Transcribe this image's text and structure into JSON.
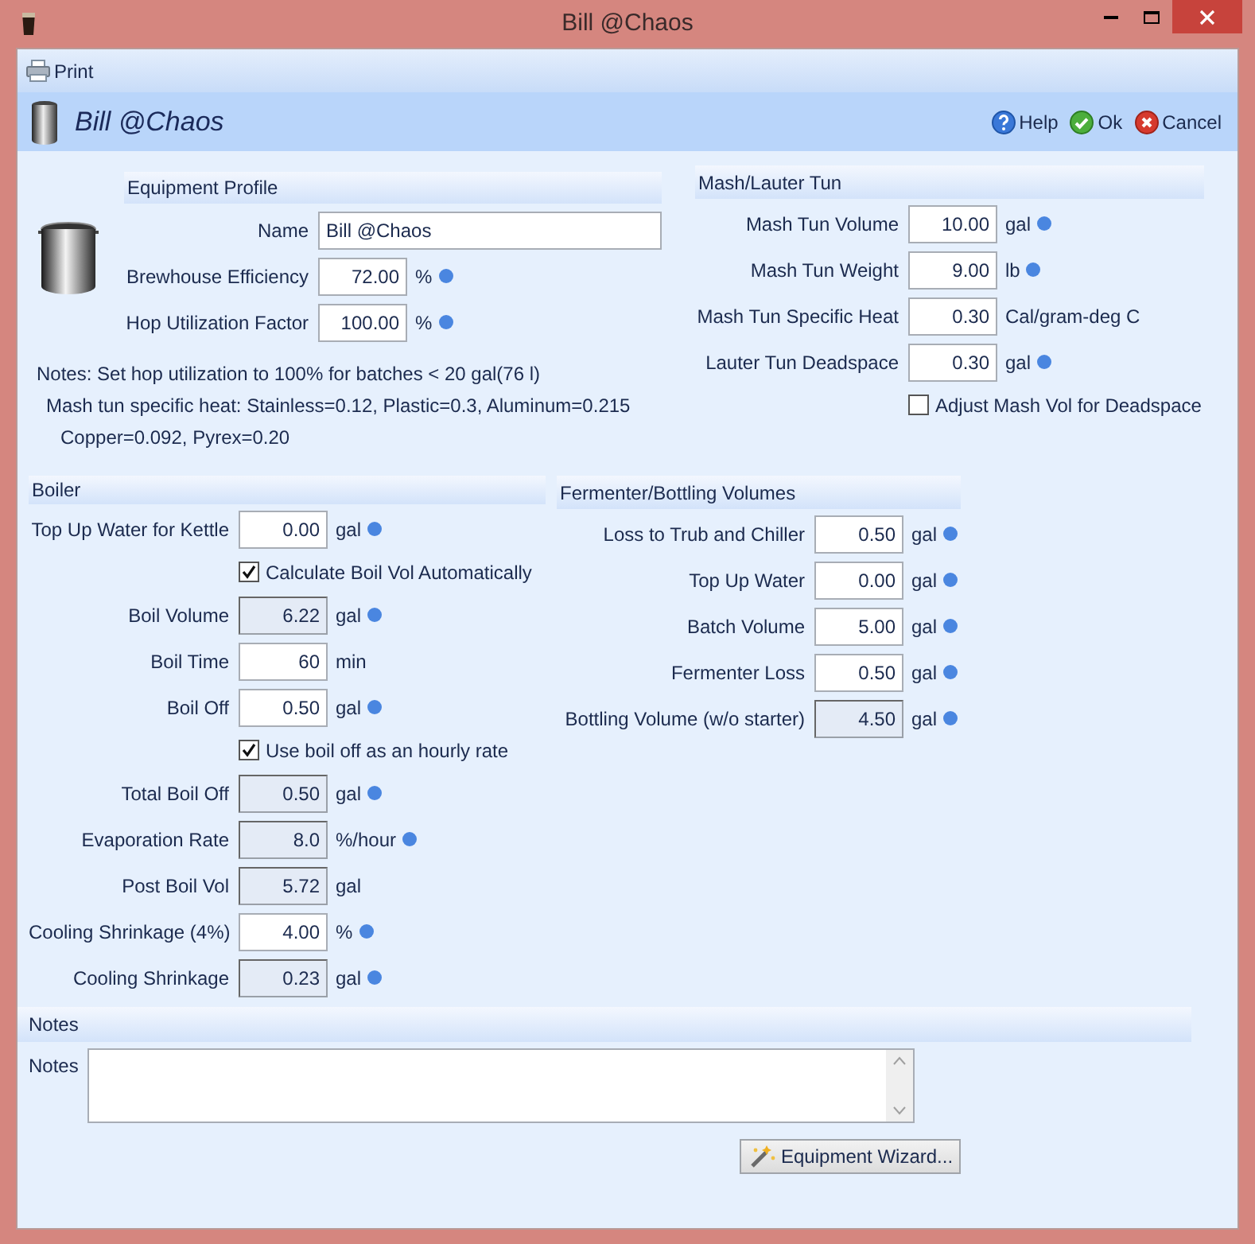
{
  "window": {
    "title": "Bill @Chaos"
  },
  "toolbar": [
    {
      "label": "Print"
    }
  ],
  "header": {
    "title": "Bill @Chaos",
    "buttons": [
      {
        "label": "Help",
        "kind": "help"
      },
      {
        "label": "Ok",
        "kind": "ok"
      },
      {
        "label": "Cancel",
        "kind": "cancel"
      }
    ]
  },
  "equipment_profile": {
    "title": "Equipment Profile",
    "rows": [
      {
        "kind": "text",
        "label": "Name",
        "value": "Bill @Chaos"
      },
      {
        "kind": "number",
        "label": "Brewhouse Efficiency",
        "value": "72.00",
        "unit": "%",
        "info": true,
        "readonly": false
      },
      {
        "kind": "number",
        "label": "Hop Utilization Factor",
        "value": "100.00",
        "unit": "%",
        "info": true,
        "readonly": false
      }
    ],
    "notes": [
      "Notes: Set hop utilization to 100% for batches < 20 gal(76 l)",
      "Mash tun specific heat: Stainless=0.12, Plastic=0.3, Aluminum=0.215",
      "Copper=0.092, Pyrex=0.20"
    ]
  },
  "mash_lauter_tun": {
    "title": "Mash/Lauter Tun",
    "rows": [
      {
        "kind": "number",
        "label": "Mash Tun Volume",
        "value": "10.00",
        "unit": "gal",
        "info": true,
        "readonly": false
      },
      {
        "kind": "number",
        "label": "Mash Tun Weight",
        "value": "9.00",
        "unit": "lb",
        "info": true,
        "readonly": false
      },
      {
        "kind": "number",
        "label": "Mash Tun Specific Heat",
        "value": "0.30",
        "unit": "Cal/gram-deg C",
        "info": false,
        "readonly": false
      },
      {
        "kind": "number",
        "label": "Lauter Tun Deadspace",
        "value": "0.30",
        "unit": "gal",
        "info": true,
        "readonly": false
      },
      {
        "kind": "checkbox",
        "label": "Adjust Mash Vol for Deadspace",
        "checked": false
      }
    ]
  },
  "boiler": {
    "title": "Boiler",
    "rows": [
      {
        "kind": "number",
        "label": "Top Up Water for Kettle",
        "value": "0.00",
        "unit": "gal",
        "info": true,
        "readonly": false
      },
      {
        "kind": "checkbox",
        "label": "Calculate Boil Vol Automatically",
        "checked": true
      },
      {
        "kind": "number",
        "label": "Boil Volume",
        "value": "6.22",
        "unit": "gal",
        "info": true,
        "readonly": true
      },
      {
        "kind": "number",
        "label": "Boil Time",
        "value": "60",
        "unit": "min",
        "info": false,
        "readonly": false
      },
      {
        "kind": "number",
        "label": "Boil Off",
        "value": "0.50",
        "unit": "gal",
        "info": true,
        "readonly": false
      },
      {
        "kind": "checkbox",
        "label": "Use boil off as an hourly rate",
        "checked": true
      },
      {
        "kind": "number",
        "label": "Total Boil Off",
        "value": "0.50",
        "unit": "gal",
        "info": true,
        "readonly": true
      },
      {
        "kind": "number",
        "label": "Evaporation Rate",
        "value": "8.0",
        "unit": "%/hour",
        "info": true,
        "readonly": true
      },
      {
        "kind": "number",
        "label": "Post Boil Vol",
        "value": "5.72",
        "unit": "gal",
        "info": false,
        "readonly": true
      },
      {
        "kind": "number",
        "label": "Cooling Shrinkage (4%)",
        "value": "4.00",
        "unit": "%",
        "info": true,
        "readonly": false
      },
      {
        "kind": "number",
        "label": "Cooling Shrinkage",
        "value": "0.23",
        "unit": "gal",
        "info": true,
        "readonly": true
      }
    ]
  },
  "fermenter_bottling_volumes": {
    "title": "Fermenter/Bottling Volumes",
    "rows": [
      {
        "kind": "number",
        "label": "Loss to Trub and Chiller",
        "value": "0.50",
        "unit": "gal",
        "info": true,
        "readonly": false
      },
      {
        "kind": "number",
        "label": "Top Up Water",
        "value": "0.00",
        "unit": "gal",
        "info": true,
        "readonly": false
      },
      {
        "kind": "number",
        "label": "Batch Volume",
        "value": "5.00",
        "unit": "gal",
        "info": true,
        "readonly": false
      },
      {
        "kind": "number",
        "label": "Fermenter Loss",
        "value": "0.50",
        "unit": "gal",
        "info": true,
        "readonly": false
      },
      {
        "kind": "number",
        "label": "Bottling Volume (w/o starter)",
        "value": "4.50",
        "unit": "gal",
        "info": true,
        "readonly": true
      }
    ]
  },
  "notes": {
    "title": "Notes",
    "label": "Notes"
  },
  "wizard_button": {
    "label": "Equipment Wizard..."
  }
}
